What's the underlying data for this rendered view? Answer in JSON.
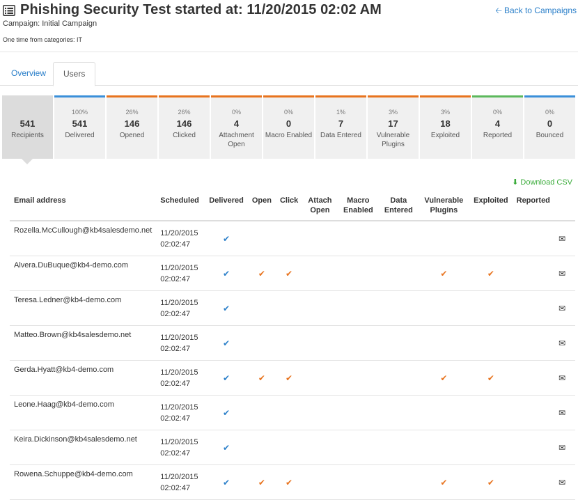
{
  "header": {
    "title": "Phishing Security Test started at: 11/20/2015 02:02 AM",
    "title_icon": "list-icon",
    "campaign": "Campaign: Initial Campaign",
    "categories": "One time from categories: IT",
    "back_link": "Back to Campaigns"
  },
  "tabs": [
    {
      "label": "Overview",
      "active": false
    },
    {
      "label": "Users",
      "active": true
    }
  ],
  "stats": [
    {
      "pct": "",
      "value": "541",
      "label": "Recipients",
      "color": ""
    },
    {
      "pct": "100%",
      "value": "541",
      "label": "Delivered",
      "color": "#3a8fd9"
    },
    {
      "pct": "26%",
      "value": "146",
      "label": "Opened",
      "color": "#e8731e"
    },
    {
      "pct": "26%",
      "value": "146",
      "label": "Clicked",
      "color": "#e8731e"
    },
    {
      "pct": "0%",
      "value": "4",
      "label": "Attachment Open",
      "color": "#e8731e"
    },
    {
      "pct": "0%",
      "value": "0",
      "label": "Macro Enabled",
      "color": "#e8731e"
    },
    {
      "pct": "1%",
      "value": "7",
      "label": "Data Entered",
      "color": "#e8731e"
    },
    {
      "pct": "3%",
      "value": "17",
      "label": "Vulnerable Plugins",
      "color": "#e8731e"
    },
    {
      "pct": "3%",
      "value": "18",
      "label": "Exploited",
      "color": "#e8731e"
    },
    {
      "pct": "0%",
      "value": "4",
      "label": "Reported",
      "color": "#5cb85c"
    },
    {
      "pct": "0%",
      "value": "0",
      "label": "Bounced",
      "color": "#3a8fd9"
    }
  ],
  "download_label": "Download CSV",
  "table": {
    "columns": [
      "Email address",
      "Scheduled",
      "Delivered",
      "Open",
      "Click",
      "Attach Open",
      "Macro Enabled",
      "Data Entered",
      "Vulnerable Plugins",
      "Exploited",
      "Reported",
      ""
    ],
    "rows": [
      {
        "email": "Rozella.McCullough@kb4salesdemo.net",
        "date": "11/20/2015",
        "time": "02:02:47",
        "delivered": true,
        "open": false,
        "click": false,
        "exploited": false,
        "plugins": false
      },
      {
        "email": "Alvera.DuBuque@kb4-demo.com",
        "date": "11/20/2015",
        "time": "02:02:47",
        "delivered": true,
        "open": true,
        "click": true,
        "exploited": true,
        "plugins": true
      },
      {
        "email": "Teresa.Ledner@kb4-demo.com",
        "date": "11/20/2015",
        "time": "02:02:47",
        "delivered": true,
        "open": false,
        "click": false,
        "exploited": false,
        "plugins": false
      },
      {
        "email": "Matteo.Brown@kb4salesdemo.net",
        "date": "11/20/2015",
        "time": "02:02:47",
        "delivered": true,
        "open": false,
        "click": false,
        "exploited": false,
        "plugins": false
      },
      {
        "email": "Gerda.Hyatt@kb4-demo.com",
        "date": "11/20/2015",
        "time": "02:02:47",
        "delivered": true,
        "open": true,
        "click": true,
        "exploited": true,
        "plugins": true
      },
      {
        "email": "Leone.Haag@kb4-demo.com",
        "date": "11/20/2015",
        "time": "02:02:47",
        "delivered": true,
        "open": false,
        "click": false,
        "exploited": false,
        "plugins": false
      },
      {
        "email": "Keira.Dickinson@kb4salesdemo.net",
        "date": "11/20/2015",
        "time": "02:02:47",
        "delivered": true,
        "open": false,
        "click": false,
        "exploited": false,
        "plugins": false
      },
      {
        "email": "Rowena.Schuppe@kb4-demo.com",
        "date": "11/20/2015",
        "time": "02:02:47",
        "delivered": true,
        "open": true,
        "click": true,
        "exploited": true,
        "plugins": true
      }
    ]
  },
  "colors": {
    "accent": "#2a7fc9",
    "warning": "#e8731e",
    "success": "#3bac3b"
  },
  "icons": {
    "check": "checkmark-icon",
    "mail": "envelope-icon",
    "download": "download-icon",
    "back": "arrow-left-icon"
  }
}
